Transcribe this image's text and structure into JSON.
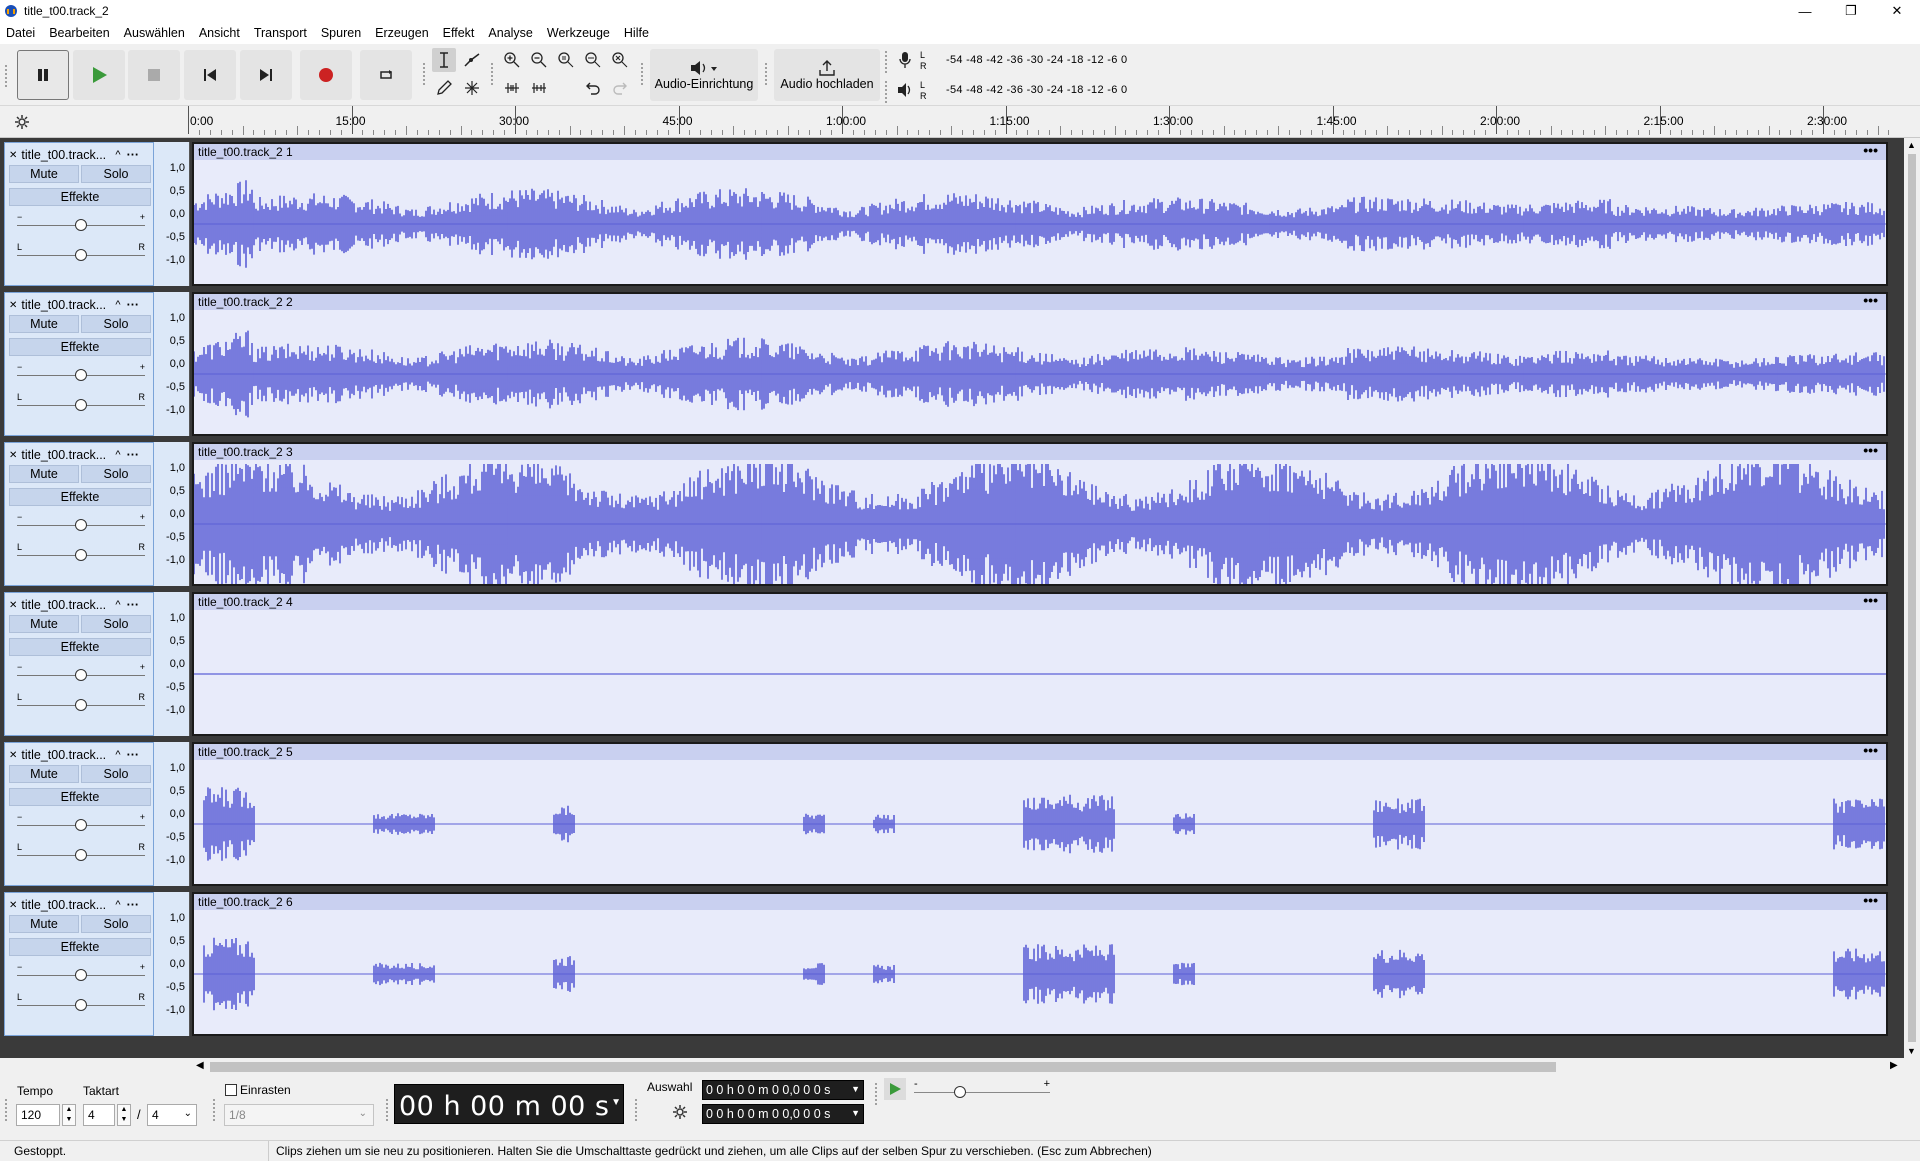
{
  "window": {
    "title": "title_t00.track_2",
    "min_glyph": "—",
    "max_glyph": "❐",
    "close_glyph": "✕"
  },
  "menu": {
    "items": [
      "Datei",
      "Bearbeiten",
      "Auswählen",
      "Ansicht",
      "Transport",
      "Spuren",
      "Erzeugen",
      "Effekt",
      "Analyse",
      "Werkzeuge",
      "Hilfe"
    ]
  },
  "toolbar": {
    "audio_setup_label": "Audio-Einrichtung",
    "share_audio_label": "Audio hochladen",
    "rec_meter_scale": "-54  -48  -42  -36  -30  -24  -18  -12   -6    0",
    "play_meter_scale": "-54  -48  -42  -36  -30  -24  -18  -12   -6    0",
    "meter_l": "L",
    "meter_r": "R"
  },
  "ruler": {
    "labels": [
      "0:00",
      "15:00",
      "30:00",
      "45:00",
      "1:00:00",
      "1:15:00",
      "1:30:00",
      "1:45:00",
      "2:00:00",
      "2:15:00",
      "2:30:00"
    ]
  },
  "track_controls": {
    "mute": "Mute",
    "solo": "Solo",
    "effects": "Effekte",
    "gain_minus": "−",
    "gain_plus": "+",
    "pan_left": "L",
    "pan_right": "R",
    "close_glyph": "✕",
    "collapse_glyph": "^",
    "menu_glyph": "···"
  },
  "vscale_labels": [
    "1,0",
    "0,5",
    "0,0",
    "-0,5",
    "-1,0"
  ],
  "tracks": [
    {
      "name": "title_t00.track...",
      "clip": "title_t00.track_2 1",
      "profile": "full"
    },
    {
      "name": "title_t00.track...",
      "clip": "title_t00.track_2 2",
      "profile": "full"
    },
    {
      "name": "title_t00.track...",
      "clip": "title_t00.track_2 3",
      "profile": "dense"
    },
    {
      "name": "title_t00.track...",
      "clip": "title_t00.track_2 4",
      "profile": "flat"
    },
    {
      "name": "title_t00.track...",
      "clip": "title_t00.track_2 5",
      "profile": "sparse"
    },
    {
      "name": "title_t00.track...",
      "clip": "title_t00.track_2 6",
      "profile": "sparse"
    }
  ],
  "clip_menu_glyph": "•••",
  "bottom": {
    "tempo_label": "Tempo",
    "tempo_value": "120",
    "time_sig_label": "Taktart",
    "time_sig_num": "4",
    "time_sig_sep": "/",
    "time_sig_den": "4",
    "snap_label": "Einrasten",
    "snap_value": "1/8",
    "time_display": "00 h 00 m 00 s",
    "selection_label": "Auswahl",
    "selection_start": "0 0 h 0 0 m 0 0,0 0 0 s",
    "selection_end": "0 0 h 0 0 m 0 0,0 0 0 s",
    "speed_minus": "-",
    "speed_plus": "+"
  },
  "status": {
    "state": "Gestoppt.",
    "hint": "Clips ziehen um sie neu zu positionieren. Halten Sie die Umschalttaste gedrückt und ziehen, um alle Clips auf der selben Spur zu verschieben. (Esc zum Abbrechen)"
  },
  "colors": {
    "waveform": "#5b5fd6",
    "clip_bg": "#e8ebfa",
    "clip_header": "#c9d0f0",
    "track_ctrl_bg": "#dce8f8",
    "record": "#cc2222",
    "play": "#3a9a3a"
  }
}
